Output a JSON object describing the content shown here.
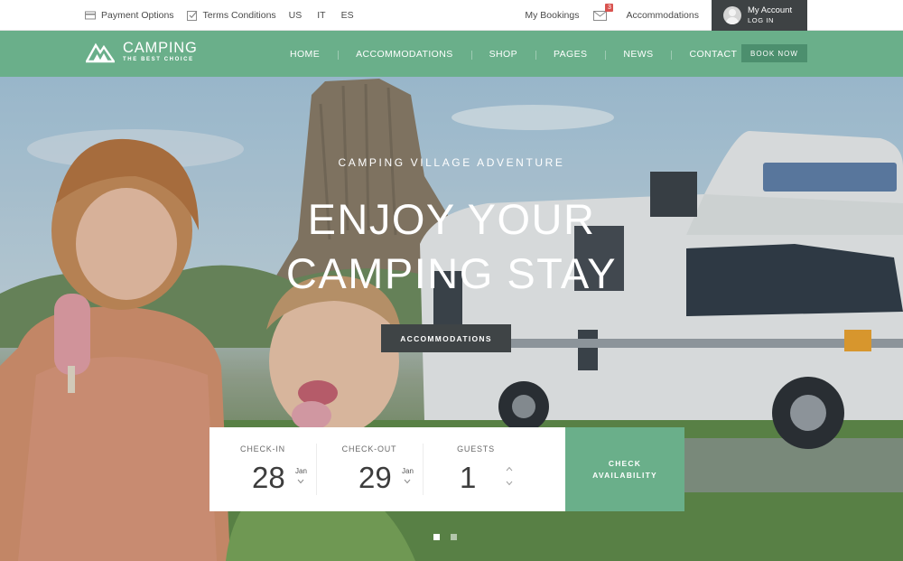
{
  "topbar": {
    "payment_label": "Payment Options",
    "terms_label": "Terms Conditions",
    "languages": [
      "US",
      "IT",
      "ES"
    ],
    "bookings_label": "My Bookings",
    "mail_count": "3",
    "accommodations_label": "Accommodations",
    "account_title": "My Account",
    "account_sub": "LOG IN"
  },
  "brand": {
    "name": "CAMPING",
    "tagline": "THE BEST CHOICE"
  },
  "nav": {
    "items": [
      "HOME",
      "ACCOMMODATIONS",
      "SHOP",
      "PAGES",
      "NEWS",
      "CONTACT"
    ],
    "book_label": "BOOK NOW"
  },
  "hero": {
    "kicker": "CAMPING VILLAGE ADVENTURE",
    "title_line1": "ENJOY YOUR",
    "title_line2": "CAMPING STAY",
    "button_label": "ACCOMMODATIONS"
  },
  "booking": {
    "checkin_label": "CHECK-IN",
    "checkin_day": "28",
    "checkin_month": "Jan",
    "checkout_label": "CHECK-OUT",
    "checkout_day": "29",
    "checkout_month": "Jan",
    "guests_label": "GUESTS",
    "guests_value": "1",
    "check_label_1": "CHECK",
    "check_label_2": "AVAILABILITY"
  },
  "slider": {
    "count": 2,
    "active": 0
  },
  "colors": {
    "accent": "#6aaf8a",
    "dark": "#3e4244",
    "badge": "#d9534f"
  },
  "icons": {
    "payment": "credit-card-icon",
    "terms": "checkbox-icon",
    "mail": "envelope-icon",
    "avatar": "user-avatar",
    "logo": "mountain-logo-icon"
  }
}
